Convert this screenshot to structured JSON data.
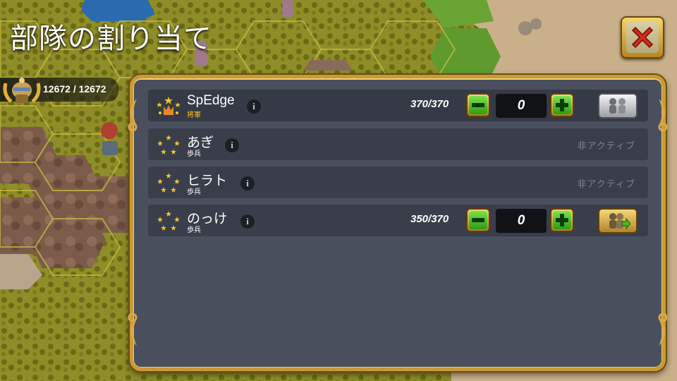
{
  "screen": {
    "title": "部隊の割り当て"
  },
  "resource": {
    "value_text": "12672 / 12672",
    "icon": "laurel-helmet-icon"
  },
  "close_button": {
    "icon": "close-x-icon"
  },
  "units": [
    {
      "name": "SpEdge",
      "type_label": "将軍",
      "troops": "370/370",
      "assigned": "0",
      "status": "active",
      "icon": "general-crown-stars-icon",
      "action_icon": "troops-silver-icon"
    },
    {
      "name": "あぎ",
      "type_label": "歩兵",
      "status_text": "非アクティブ",
      "icon": "stars-circle-icon"
    },
    {
      "name": "ヒラト",
      "type_label": "歩兵",
      "status_text": "非アクティブ",
      "icon": "stars-circle-icon"
    },
    {
      "name": "のっけ",
      "type_label": "歩兵",
      "troops": "350/370",
      "assigned": "0",
      "status": "active",
      "icon": "stars-circle-icon",
      "action_icon": "troops-assign-icon"
    }
  ],
  "colors": {
    "panel_border": "#c79a34",
    "panel_bg": "#4a4f5e",
    "row_bg": "#3a3e4b",
    "accent_green": "#46b823",
    "general_label": "#f2c52a",
    "inactive_text": "#7c808d",
    "close_red": "#d3291c"
  }
}
